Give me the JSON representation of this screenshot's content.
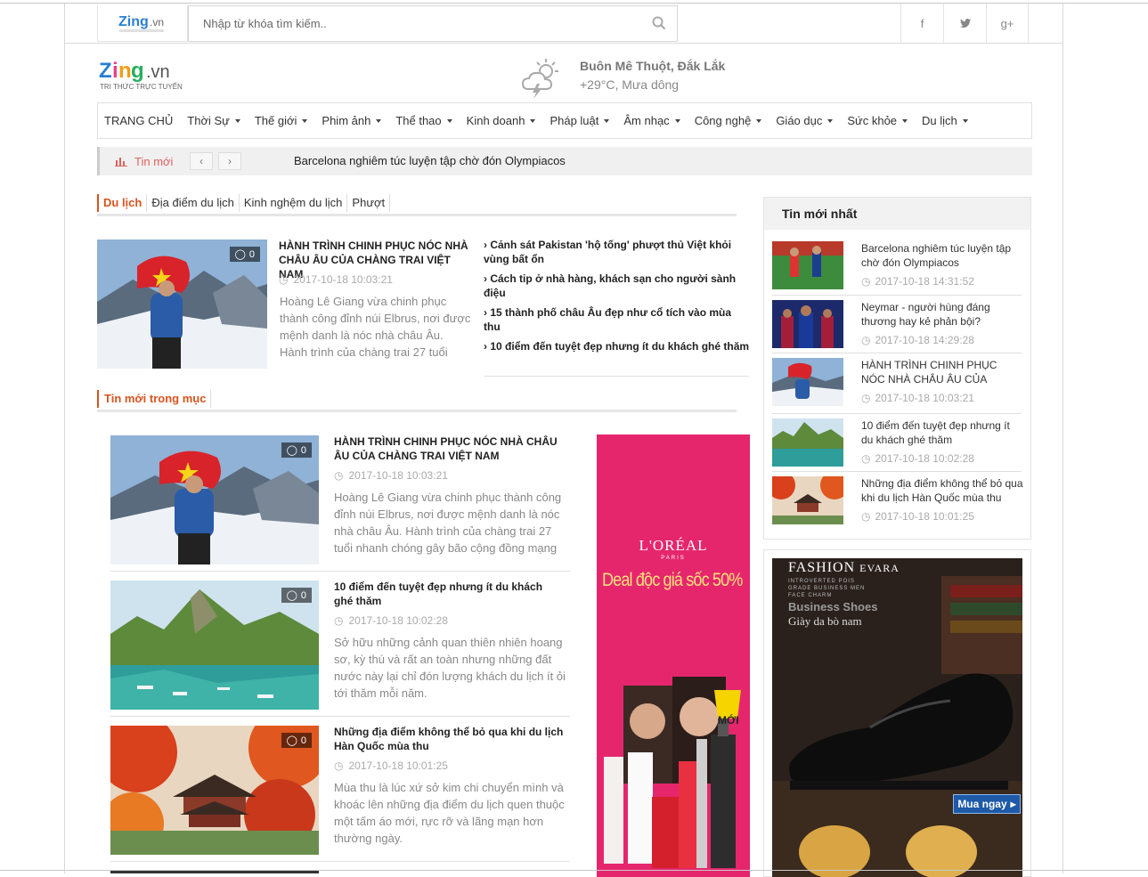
{
  "search": {
    "placeholder": "Nhập từ khóa tìm kiếm.."
  },
  "brand": {
    "name": "Zing",
    "tld": ".vn",
    "tagline": "TRI THỨC TRỰC TUYẾN"
  },
  "social": [
    "f",
    "t",
    "g+"
  ],
  "weather": {
    "city": "Buôn Mê Thuột, Đắk Lắk",
    "condition": "+29°C, Mưa dông"
  },
  "nav": {
    "home": "TRANG CHỦ",
    "items": [
      "Thời Sự",
      "Thế giới",
      "Phim ảnh",
      "Thể thao",
      "Kinh doanh",
      "Pháp luật",
      "Âm nhạc",
      "Công nghệ",
      "Giáo dục",
      "Sức khỏe",
      "Du lịch"
    ]
  },
  "ticker": {
    "label": "Tin mới",
    "headline": "Barcelona nghiêm túc luyện tập chờ đón Olympiacos"
  },
  "breadcrumb": [
    "Du lịch",
    "Địa điểm du lịch",
    "Kinh nghệm du lịch",
    "Phượt"
  ],
  "featured": {
    "title": "HÀNH TRÌNH CHINH PHỤC NÓC NHÀ CHÂU ÂU CỦA CHÀNG TRAI VIỆT NAM",
    "time": "2017-10-18 10:03:21",
    "desc": "Hoàng Lê Giang vừa chinh phục thành công đỉnh núi Elbrus, nơi được mệnh danh là nóc nhà châu Âu. Hành trình của chàng trai 27 tuổi",
    "comments": "0"
  },
  "related_links": [
    "Cảnh sát Pakistan 'hộ tống' phượt thủ Việt khỏi vùng bất ổn",
    "Cách tip ở nhà hàng, khách sạn cho người sành điệu",
    "15 thành phố châu Âu đẹp như cổ tích vào mùa thu",
    "10 điểm đến tuyệt đẹp nhưng ít du khách ghé thăm"
  ],
  "section_title": "Tin mới trong mục",
  "articles": [
    {
      "title": "HÀNH TRÌNH CHINH PHỤC NÓC NHÀ CHÂU ÂU CỦA CHÀNG TRAI VIỆT NAM",
      "time": "2017-10-18 10:03:21",
      "desc": "Hoàng Lê Giang vừa chinh phục thành công đỉnh núi Elbrus, nơi được mệnh danh là nóc nhà châu Âu. Hành trình của chàng trai 27 tuổi nhanh chóng gây bão cộng đồng mạng",
      "comments": "0"
    },
    {
      "title": "10 điểm đến tuyệt đẹp nhưng ít du khách ghé thăm",
      "time": "2017-10-18 10:02:28",
      "desc": "Sở hữu những cảnh quan thiên nhiên hoang sơ, kỳ thú và rất an toàn nhưng những đất nước này lại chỉ đón lượng khách du lịch ít ỏi tới thăm mỗi năm.",
      "comments": "0"
    },
    {
      "title": "Những địa điểm không thể bỏ qua khi du lịch Hàn Quốc mùa thu",
      "time": "2017-10-18 10:01:25",
      "desc": "Mùa thu là lúc xứ sở kim chi chuyển mình và khoác lên những địa điểm du lịch quen thuộc một tấm áo mới, rực rỡ và lãng mạn hơn thường ngày.",
      "comments": "0"
    }
  ],
  "ad_loreal": {
    "brand": "L'ORÉAL",
    "sub": "PARIS",
    "text": "Deal độc giá sốc 50%",
    "badge": "MỚI"
  },
  "sidebar": {
    "title": "Tin mới nhất",
    "items": [
      {
        "title": "Barcelona nghiêm túc luyện tập chờ đón Olympiacos",
        "time": "2017-10-18 14:31:52"
      },
      {
        "title": "Neymar - người hùng đáng thương hay kẻ phản bội?",
        "time": "2017-10-18 14:29:28"
      },
      {
        "title": "HÀNH TRÌNH CHINH PHỤC NÓC NHÀ CHÂU ÂU CỦA CHÀNG TRAI VIỆT NAM",
        "time": "2017-10-18 10:03:21"
      },
      {
        "title": "10 điểm đến tuyệt đẹp nhưng ít du khách ghé thăm",
        "time": "2017-10-18 10:02:28"
      },
      {
        "title": "Những địa điểm không thể bỏ qua khi du lịch Hàn Quốc mùa thu",
        "time": "2017-10-18 10:01:25"
      }
    ]
  },
  "ad_fashion": {
    "brand": "FASHION",
    "brand2": "EVARA",
    "tag1": "INTROVERTED POIS",
    "tag2": "GRADE BUSINESS MEN",
    "tag3": "FACE CHARM",
    "line1": "Business Shoes",
    "line2": "Giày da bò nam",
    "cta": "Mua ngay"
  },
  "colors": {
    "accent": "#d9531e",
    "ticker_label": "#e06060",
    "ad_pink": "#e5266d"
  }
}
